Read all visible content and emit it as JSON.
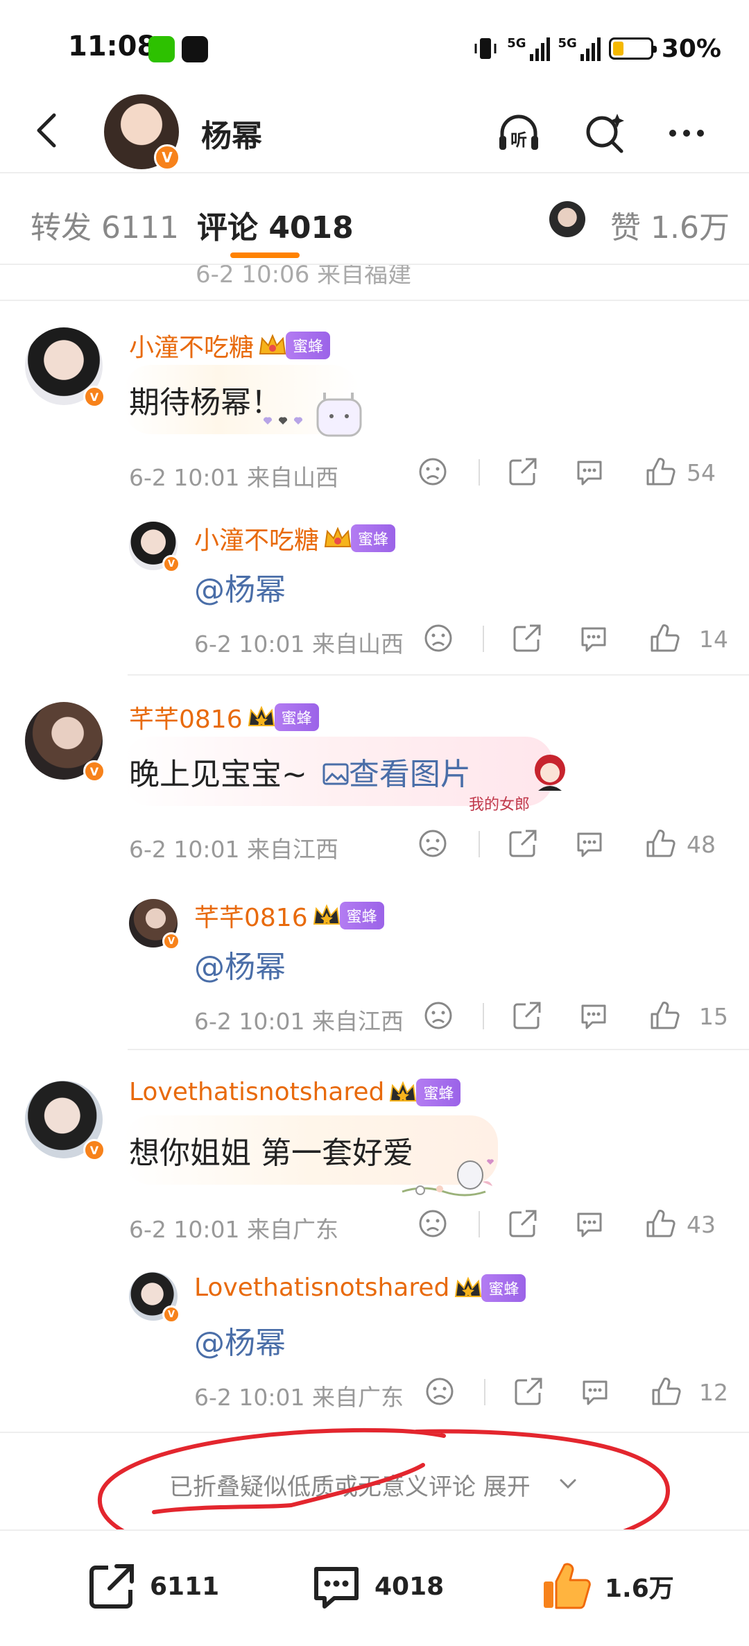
{
  "status_bar": {
    "time": "11:08",
    "network_1": "5G",
    "network_2": "5G",
    "battery_percent": "30%",
    "battery_level": 0.3
  },
  "nav": {
    "title": "杨幂",
    "icons": [
      "back-icon",
      "listen-icon",
      "search-icon",
      "more-icon"
    ],
    "listen_label": "听"
  },
  "tabs": {
    "repost": "转发 6111",
    "comment": "评论 4018",
    "likes": "赞 1.6万"
  },
  "clipped_row": {
    "meta": "6-2 10:06 来自福建"
  },
  "comments": [
    {
      "user": "小潼不吃糖",
      "badge": "蜜蜂",
      "text": "期待杨幂！",
      "meta": "6-2 10:01 来自山西",
      "likes": "54",
      "reply": {
        "user": "小潼不吃糖",
        "badge": "蜜蜂",
        "text": "@杨幂",
        "meta": "6-2 10:01 来自山西",
        "likes": "14"
      }
    },
    {
      "user": "芊芊0816",
      "badge": "蜜蜂",
      "text": "晚上见宝宝~",
      "link": "查看图片",
      "sticker_text": "我的女郎",
      "meta": "6-2 10:01 来自江西",
      "likes": "48",
      "reply": {
        "user": "芊芊0816",
        "badge": "蜜蜂",
        "text": "@杨幂",
        "meta": "6-2 10:01 来自江西",
        "likes": "15"
      }
    },
    {
      "user": "Lovethatisnotshared",
      "badge": "蜜蜂",
      "text": "想你姐姐 第一套好爱",
      "meta": "6-2 10:01 来自广东",
      "likes": "43",
      "reply": {
        "user": "Lovethatisnotshared",
        "badge": "蜜蜂",
        "text": "@杨幂",
        "meta": "6-2 10:01 来自广东",
        "likes": "12"
      }
    }
  ],
  "folded_notice": {
    "text": "已折叠疑似低质或无意义评论 展开"
  },
  "bottom_bar": {
    "repost_count": "6111",
    "comment_count": "4018",
    "like_count": "1.6万"
  },
  "colors": {
    "accent": "#ff8200",
    "username": "#e86a0c",
    "link": "#4a6ea8",
    "badge": "#a56ef0",
    "annotation": "#e3262e"
  }
}
